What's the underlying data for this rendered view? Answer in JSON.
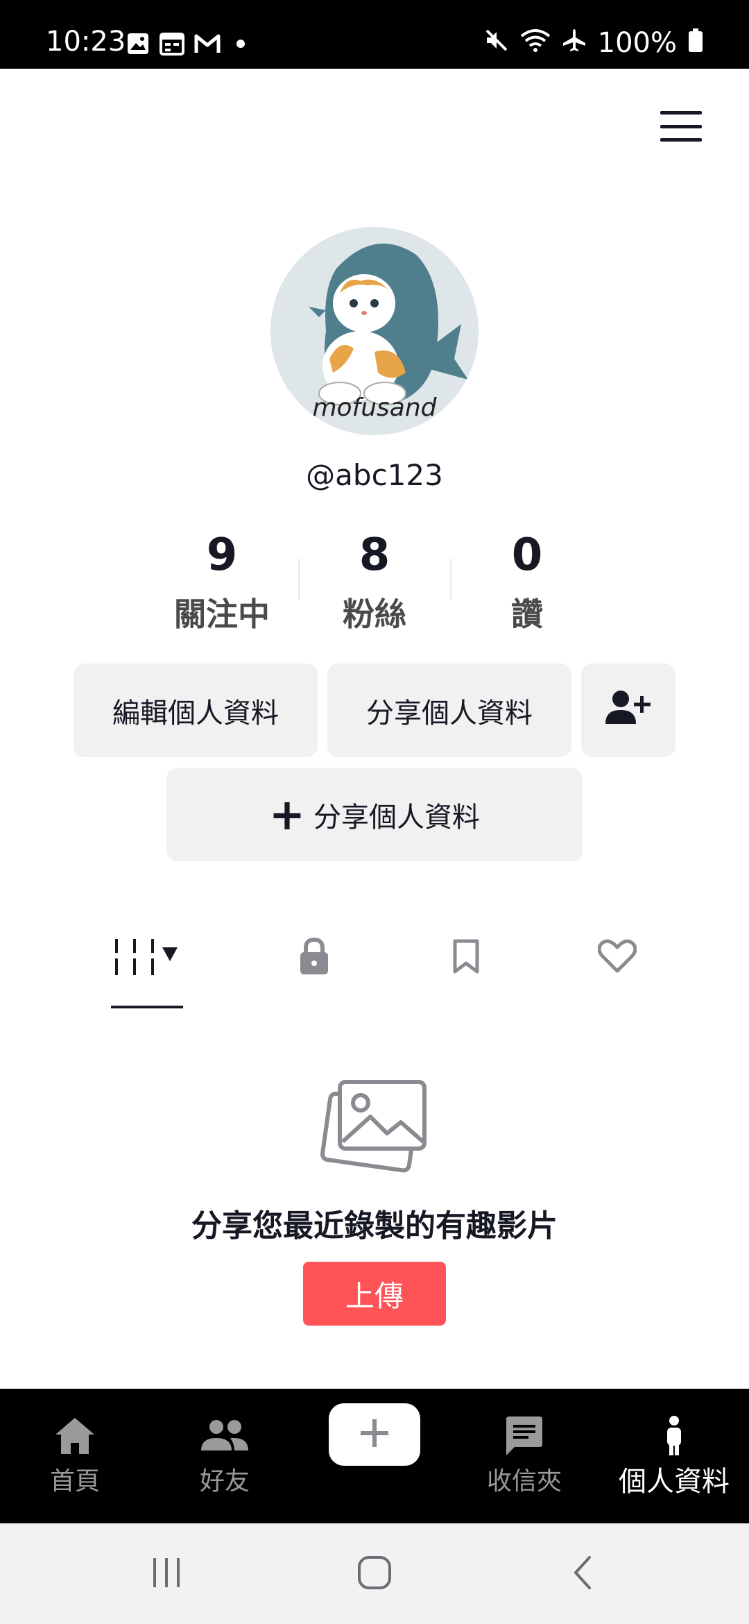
{
  "status_bar": {
    "time": "10:23",
    "battery": "100%",
    "icons": [
      "gallery-icon",
      "calendar-icon",
      "gmail-icon",
      "dot-icon",
      "mute-icon",
      "wifi-icon",
      "airplane-icon",
      "battery-icon"
    ]
  },
  "profile": {
    "username": "@abc123",
    "avatar_caption": "mofusand",
    "stats": [
      {
        "value": "9",
        "label": "關注中"
      },
      {
        "value": "8",
        "label": "粉絲"
      },
      {
        "value": "0",
        "label": "讚"
      }
    ]
  },
  "actions": {
    "edit_label": "編輯個人資料",
    "share_label": "分享個人資料",
    "add_share_plus": "+",
    "add_share_label": "分享個人資料"
  },
  "tabs": [
    "videos-grid-icon",
    "lock-icon",
    "bookmark-icon",
    "heart-icon"
  ],
  "empty_state": {
    "message": "分享您最近錄製的有趣影片",
    "upload_label": "上傳"
  },
  "bottom_nav": {
    "items": [
      {
        "label": "首頁",
        "icon": "home-icon"
      },
      {
        "label": "好友",
        "icon": "friends-icon"
      },
      {
        "label": "收信夾",
        "icon": "inbox-icon"
      },
      {
        "label": "個人資料",
        "icon": "profile-icon",
        "active": true
      }
    ],
    "create_icon": "+"
  },
  "colors": {
    "accent": "#fe5357",
    "nav_bg": "#000000",
    "button_bg": "#f1f1f2"
  }
}
